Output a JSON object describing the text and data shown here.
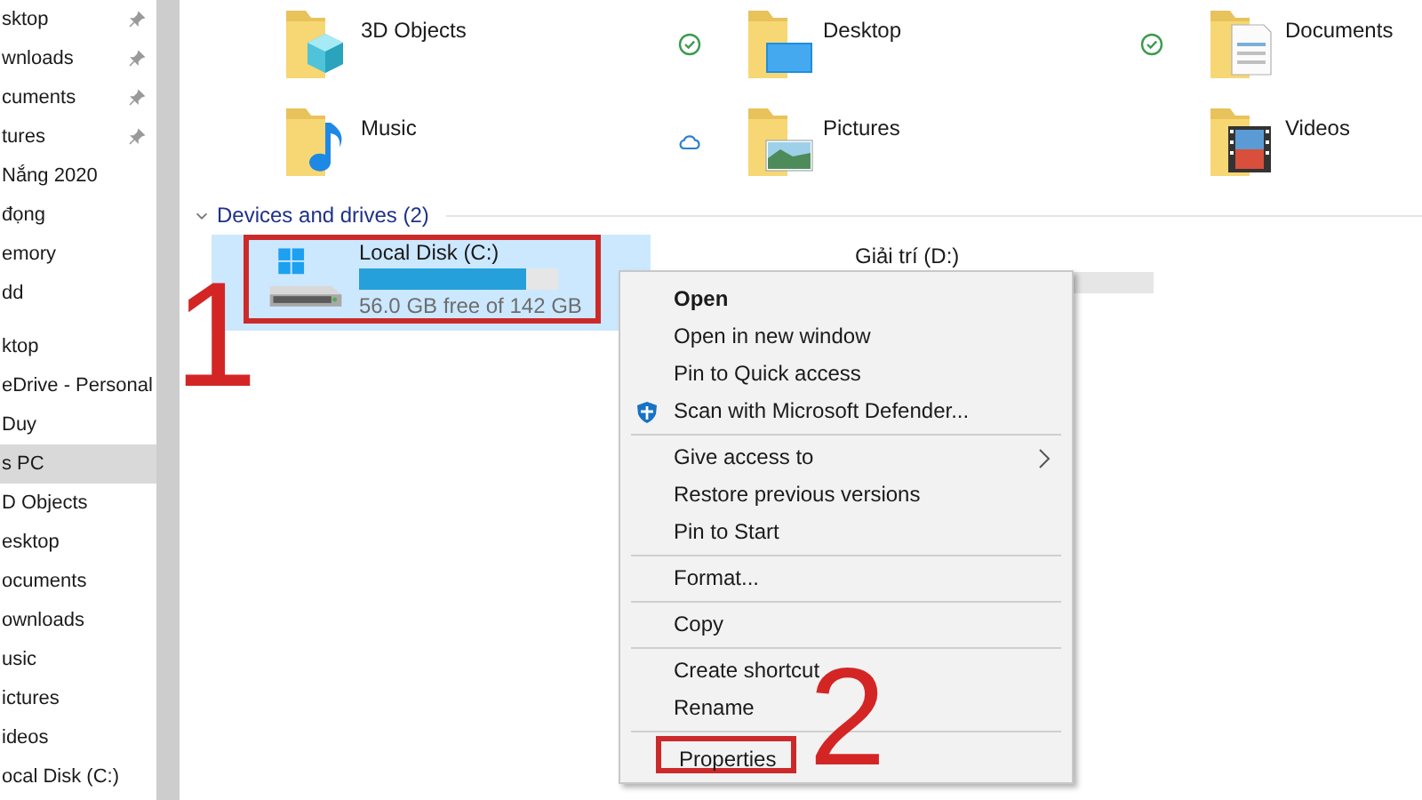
{
  "sidebar": {
    "sections": [
      {
        "items": [
          {
            "label": "sktop",
            "pinned": true,
            "selected": false
          },
          {
            "label": "wnloads",
            "pinned": true,
            "selected": false
          },
          {
            "label": "cuments",
            "pinned": true,
            "selected": false
          },
          {
            "label": "tures",
            "pinned": true,
            "selected": false
          },
          {
            "label": "Nắng 2020",
            "pinned": false,
            "selected": false
          },
          {
            "label": "đọng",
            "pinned": false,
            "selected": false
          },
          {
            "label": "emory",
            "pinned": false,
            "selected": false
          },
          {
            "label": "dd",
            "pinned": false,
            "selected": false
          }
        ]
      },
      {
        "items": [
          {
            "label": "ktop",
            "pinned": false,
            "selected": false
          },
          {
            "label": "eDrive - Personal",
            "pinned": false,
            "selected": false
          },
          {
            "label": "Duy",
            "pinned": false,
            "selected": false
          },
          {
            "label": "s PC",
            "pinned": false,
            "selected": true
          },
          {
            "label": "D Objects",
            "pinned": false,
            "selected": false
          },
          {
            "label": "esktop",
            "pinned": false,
            "selected": false
          },
          {
            "label": "ocuments",
            "pinned": false,
            "selected": false
          },
          {
            "label": "ownloads",
            "pinned": false,
            "selected": false
          },
          {
            "label": "usic",
            "pinned": false,
            "selected": false
          },
          {
            "label": "ictures",
            "pinned": false,
            "selected": false
          },
          {
            "label": "ideos",
            "pinned": false,
            "selected": false
          },
          {
            "label": "ocal Disk (C:)",
            "pinned": false,
            "selected": false
          }
        ]
      }
    ]
  },
  "folders": [
    {
      "name": "3D Objects",
      "synced": true,
      "cloud": false
    },
    {
      "name": "Desktop",
      "synced": true,
      "cloud": false
    },
    {
      "name": "Documents",
      "synced": false,
      "cloud": false
    },
    {
      "name": "Music",
      "synced": false,
      "cloud": true
    },
    {
      "name": "Pictures",
      "synced": false,
      "cloud": false
    },
    {
      "name": "Videos",
      "synced": false,
      "cloud": false
    }
  ],
  "devices": {
    "header": "Devices and drives (2)",
    "expanded": true,
    "drives": [
      {
        "name": "Local Disk (C:)",
        "selected": true,
        "highlighted": true,
        "level": 0.84,
        "free": "56.0 GB free of 142 GB"
      },
      {
        "name": "Giải trí (D:)",
        "selected": false,
        "highlighted": false
      }
    ]
  },
  "context_menu": {
    "groups": [
      [
        {
          "label": "Open",
          "kind": "default",
          "highlighted": false
        },
        {
          "label": "Open in new window",
          "kind": "plain",
          "highlighted": false
        },
        {
          "label": "Pin to Quick access",
          "kind": "plain",
          "highlighted": false
        },
        {
          "label": "Scan with Microsoft Defender...",
          "kind": "shield",
          "highlighted": false
        }
      ],
      [
        {
          "label": "Give access to",
          "kind": "submenu",
          "highlighted": false
        },
        {
          "label": "Restore previous versions",
          "kind": "plain",
          "highlighted": false
        },
        {
          "label": "Pin to Start",
          "kind": "plain",
          "highlighted": false
        }
      ],
      [
        {
          "label": "Format...",
          "kind": "plain",
          "highlighted": false
        }
      ],
      [
        {
          "label": "Copy",
          "kind": "plain",
          "highlighted": false
        }
      ],
      [
        {
          "label": "Create shortcut",
          "kind": "plain",
          "highlighted": false
        },
        {
          "label": "Rename",
          "kind": "plain",
          "highlighted": false
        }
      ],
      [
        {
          "label": "Properties",
          "kind": "plain",
          "highlighted": true
        }
      ]
    ]
  },
  "annotations": [
    {
      "label": "1"
    },
    {
      "label": "2"
    }
  ]
}
